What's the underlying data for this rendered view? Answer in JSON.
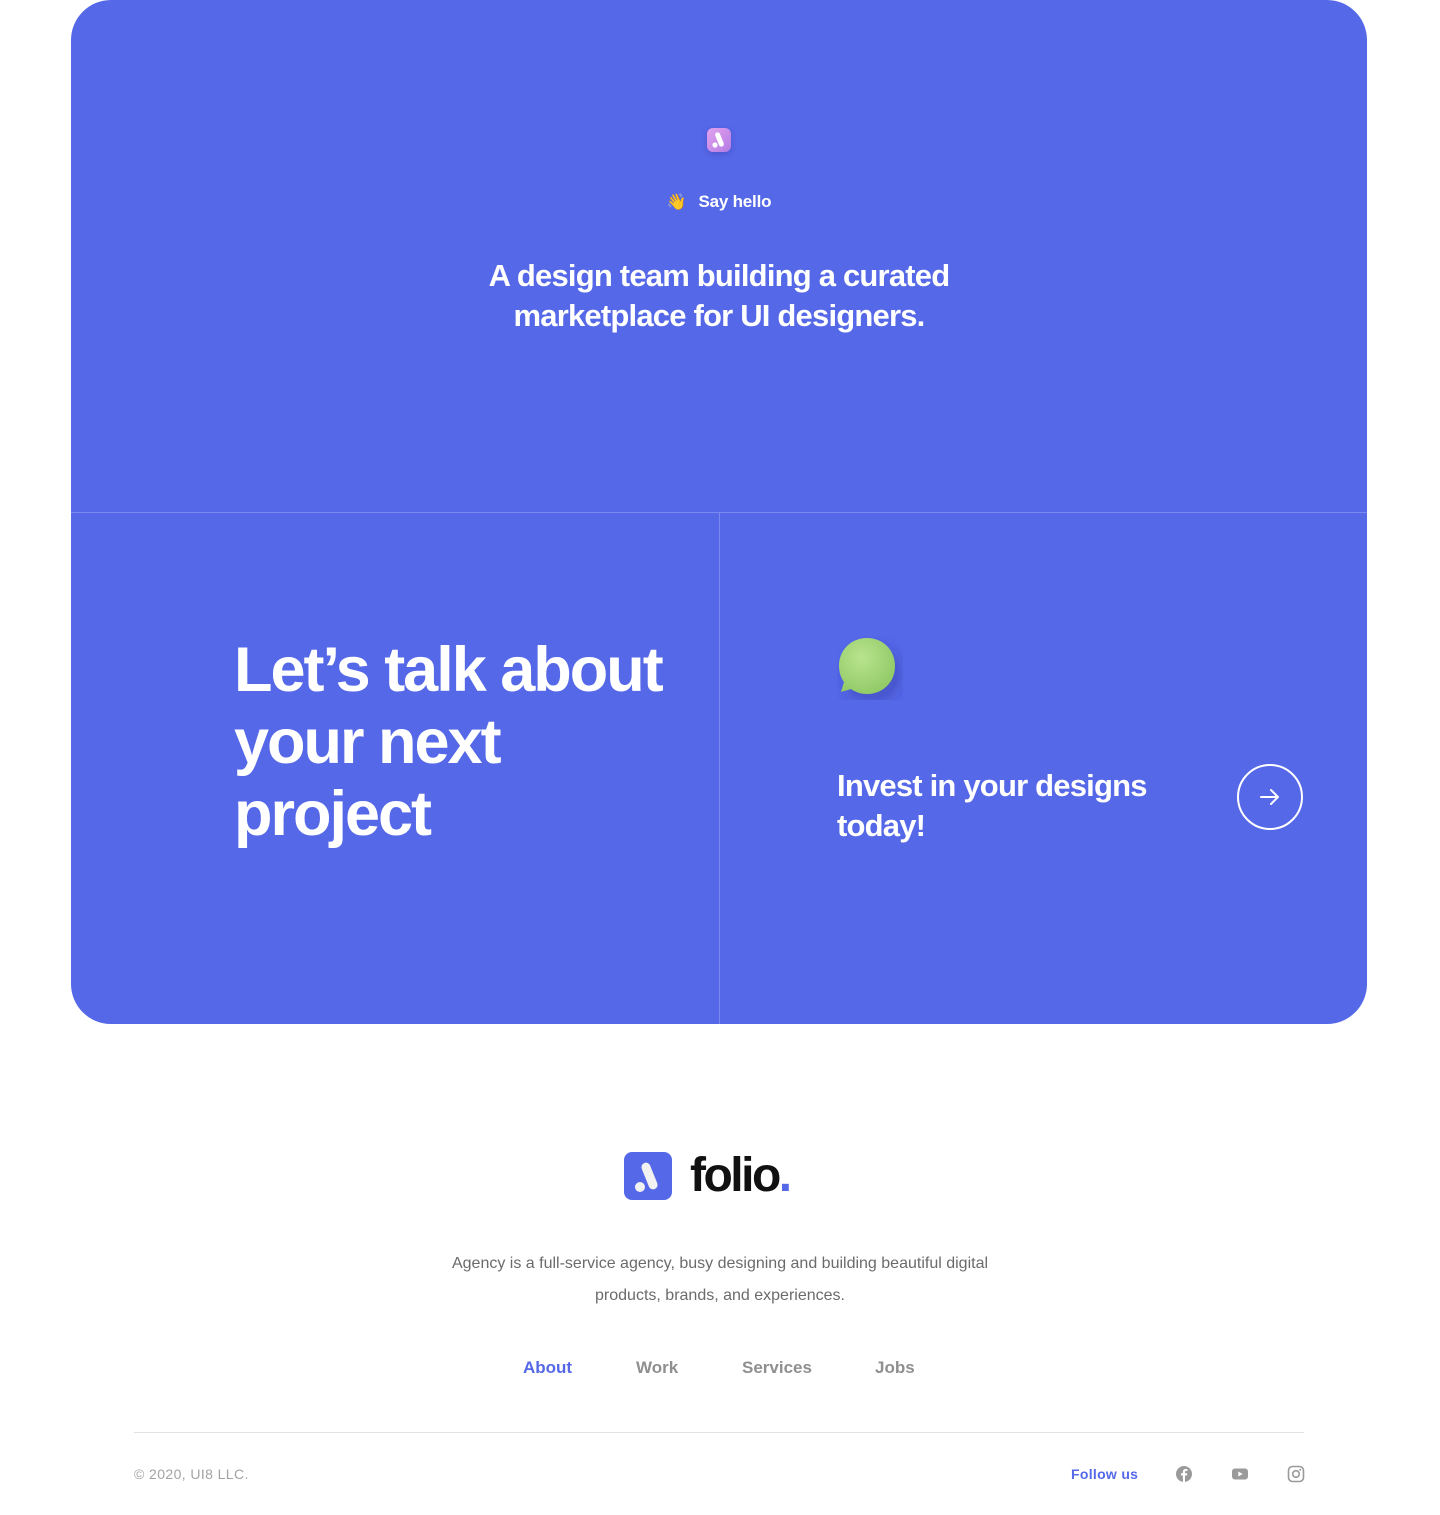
{
  "hero": {
    "icon": "app-logo-icon",
    "greeting_emoji": "👋",
    "greeting": "Say hello",
    "tagline": "A design team building a curated marketplace for UI designers.",
    "cta_heading": "Let’s talk about your next project",
    "chat_icon": "chat-bubble-icon",
    "invest_heading": "Invest in your designs today!",
    "arrow_icon": "arrow-right-icon",
    "background_color": "#5568e8",
    "chat_bubble_color": "#a5d87c"
  },
  "footer": {
    "logo_text": "folio",
    "logo_dot": ".",
    "description": "Agency is a full-service agency, busy designing and building beautiful digital products, brands, and experiences.",
    "nav": [
      {
        "label": "About",
        "active": true
      },
      {
        "label": "Work",
        "active": false
      },
      {
        "label": "Services",
        "active": false
      },
      {
        "label": "Jobs",
        "active": false
      }
    ],
    "copyright": "© 2020, UI8 LLC.",
    "follow_label": "Follow us",
    "social_icons": [
      "facebook-icon",
      "youtube-icon",
      "instagram-icon"
    ],
    "accent_color": "#5568e8"
  }
}
